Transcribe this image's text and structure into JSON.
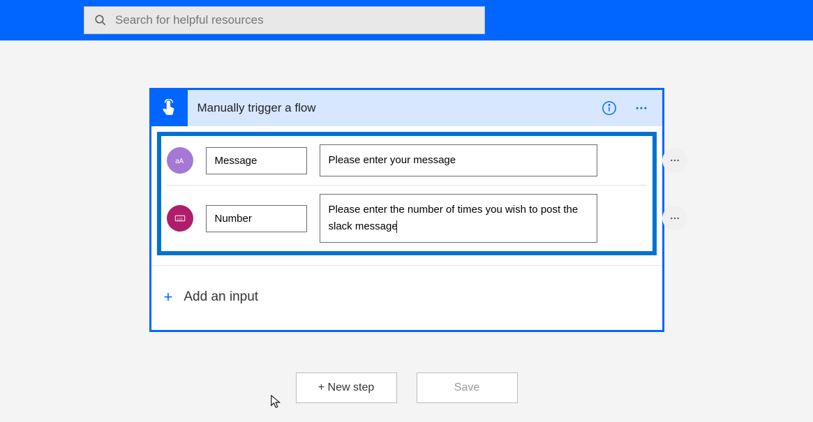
{
  "search": {
    "placeholder": "Search for helpful resources"
  },
  "trigger": {
    "title": "Manually trigger a flow",
    "inputs": [
      {
        "type": "text",
        "name": "Message",
        "description": "Please enter your message"
      },
      {
        "type": "number",
        "name": "Number",
        "description": "Please enter the number of times you wish to post the slack message"
      }
    ],
    "add_input_label": "Add an input"
  },
  "actions": {
    "new_step": "+ New step",
    "save": "Save"
  },
  "colors": {
    "primary_blue": "#0066ff",
    "highlight_border": "#0072d1",
    "header_bg": "#d7e7ff",
    "text_type_bg": "#a678d6",
    "num_type_bg": "#b01d6a"
  }
}
